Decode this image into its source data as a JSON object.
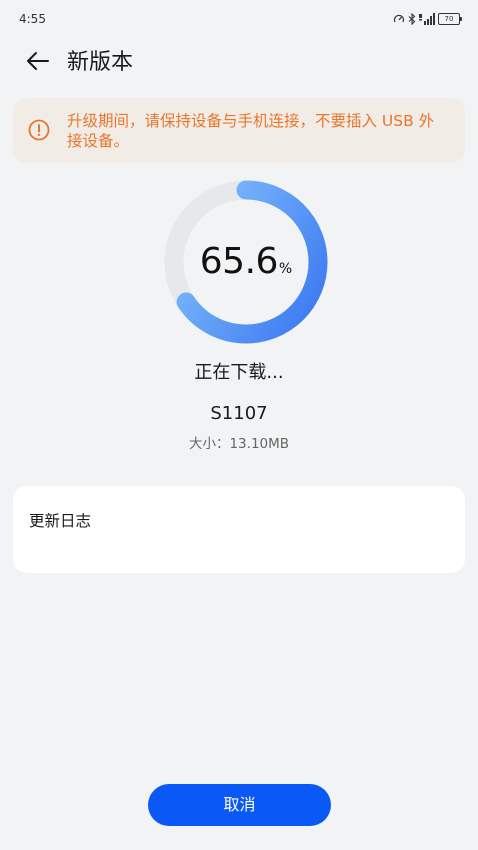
{
  "status_bar": {
    "time": "4:55",
    "battery": "70",
    "icons": [
      "speed-icon",
      "bluetooth-icon",
      "signal-icon",
      "battery-icon"
    ]
  },
  "header": {
    "back_icon": "arrow-left-icon",
    "title": "新版本"
  },
  "warning": {
    "icon": "alert-circle-icon",
    "text": "升级期间，请保持设备与手机连接，不要插入 USB 外接设备。",
    "color": "#e8772e",
    "background": "#f2ece6"
  },
  "progress": {
    "value": "65.6",
    "unit": "%",
    "fraction": 0.656,
    "track_color": "#e6e8eb",
    "gradient_start": "#84c2fc",
    "gradient_end": "#3f7cf2"
  },
  "download": {
    "status": "正在下载...",
    "version": "S1107",
    "size": "大小：13.10MB"
  },
  "changelog": {
    "title": "更新日志"
  },
  "actions": {
    "cancel_label": "取消",
    "accent": "#0a59f7"
  }
}
